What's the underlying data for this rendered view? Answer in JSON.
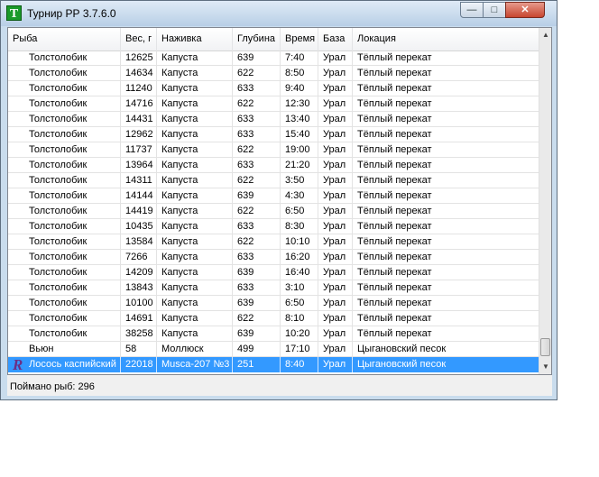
{
  "window": {
    "title": "Турнир РР 3.7.6.0",
    "icon_letter": "T"
  },
  "titlebar_buttons": {
    "minimize": "—",
    "maximize": "□",
    "close": "✕"
  },
  "columns": [
    "Рыба",
    "Вес, г",
    "Наживка",
    "Глубина",
    "Время",
    "База",
    "Локация"
  ],
  "rows": [
    [
      "Толстолобик",
      "12625",
      "Капуста",
      "639",
      "7:40",
      "Урал",
      "Тёплый перекат"
    ],
    [
      "Толстолобик",
      "14634",
      "Капуста",
      "622",
      "8:50",
      "Урал",
      "Тёплый перекат"
    ],
    [
      "Толстолобик",
      "11240",
      "Капуста",
      "633",
      "9:40",
      "Урал",
      "Тёплый перекат"
    ],
    [
      "Толстолобик",
      "14716",
      "Капуста",
      "622",
      "12:30",
      "Урал",
      "Тёплый перекат"
    ],
    [
      "Толстолобик",
      "14431",
      "Капуста",
      "633",
      "13:40",
      "Урал",
      "Тёплый перекат"
    ],
    [
      "Толстолобик",
      "12962",
      "Капуста",
      "633",
      "15:40",
      "Урал",
      "Тёплый перекат"
    ],
    [
      "Толстолобик",
      "11737",
      "Капуста",
      "622",
      "19:00",
      "Урал",
      "Тёплый перекат"
    ],
    [
      "Толстолобик",
      "13964",
      "Капуста",
      "633",
      "21:20",
      "Урал",
      "Тёплый перекат"
    ],
    [
      "Толстолобик",
      "14311",
      "Капуста",
      "622",
      "3:50",
      "Урал",
      "Тёплый перекат"
    ],
    [
      "Толстолобик",
      "14144",
      "Капуста",
      "639",
      "4:30",
      "Урал",
      "Тёплый перекат"
    ],
    [
      "Толстолобик",
      "14419",
      "Капуста",
      "622",
      "6:50",
      "Урал",
      "Тёплый перекат"
    ],
    [
      "Толстолобик",
      "10435",
      "Капуста",
      "633",
      "8:30",
      "Урал",
      "Тёплый перекат"
    ],
    [
      "Толстолобик",
      "13584",
      "Капуста",
      "622",
      "10:10",
      "Урал",
      "Тёплый перекат"
    ],
    [
      "Толстолобик",
      "7266",
      "Капуста",
      "633",
      "16:20",
      "Урал",
      "Тёплый перекат"
    ],
    [
      "Толстолобик",
      "14209",
      "Капуста",
      "639",
      "16:40",
      "Урал",
      "Тёплый перекат"
    ],
    [
      "Толстолобик",
      "13843",
      "Капуста",
      "633",
      "3:10",
      "Урал",
      "Тёплый перекат"
    ],
    [
      "Толстолобик",
      "10100",
      "Капуста",
      "639",
      "6:50",
      "Урал",
      "Тёплый перекат"
    ],
    [
      "Толстолобик",
      "14691",
      "Капуста",
      "622",
      "8:10",
      "Урал",
      "Тёплый перекат"
    ],
    [
      "Толстолобик",
      "38258",
      "Капуста",
      "639",
      "10:20",
      "Урал",
      "Тёплый перекат"
    ],
    [
      "Вьюн",
      "58",
      "Моллюск",
      "499",
      "17:10",
      "Урал",
      "Цыгановский песок"
    ],
    [
      "Лосось каспийский",
      "22018",
      "Musca-207 №3",
      "251",
      "8:40",
      "Урал",
      "Цыгановский песок"
    ]
  ],
  "selected_row": 20,
  "selected_row_icon": "R",
  "status": "Поймано рыб: 296",
  "colors": {
    "selection": "#3399ff",
    "titlebar": "#b8cfe6",
    "app_icon": "#1a9a2a"
  }
}
